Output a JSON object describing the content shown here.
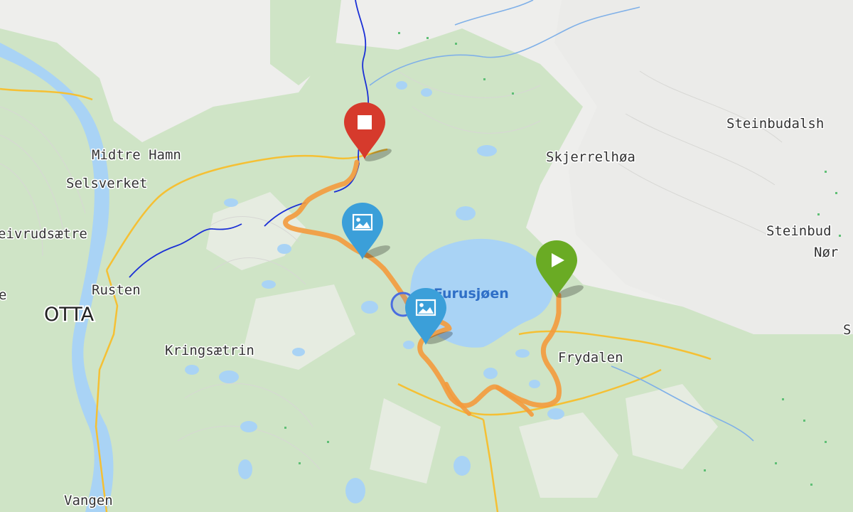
{
  "map": {
    "places": [
      {
        "key": "midtre-hamn",
        "name": "Midtre Hamn"
      },
      {
        "key": "selsverket",
        "name": "Selsverket"
      },
      {
        "key": "eivrudsaetre",
        "name": "eivrudsætre"
      },
      {
        "key": "rusten",
        "name": "Rusten"
      },
      {
        "key": "otta",
        "name": "OTTA"
      },
      {
        "key": "kringsaetrin",
        "name": "Kringsætrin"
      },
      {
        "key": "vangen",
        "name": "Vangen"
      },
      {
        "key": "skjerrelhoa",
        "name": "Skjerrelhøa"
      },
      {
        "key": "steinbudalsh",
        "name": "Steinbudalsh"
      },
      {
        "key": "steinbud",
        "name": "Steinbud"
      },
      {
        "key": "nor",
        "name": "Nør"
      },
      {
        "key": "frydalen",
        "name": "Frydalen"
      },
      {
        "key": "s-edge",
        "name": "S"
      },
      {
        "key": "e-edge",
        "name": "e"
      }
    ],
    "lake_name": "Furusjøen",
    "markers": [
      {
        "key": "end",
        "type": "stop",
        "icon": "stop-square-icon",
        "color": "#d63a2c"
      },
      {
        "key": "photo1",
        "type": "photo",
        "icon": "image-icon",
        "color": "#3b9fd9"
      },
      {
        "key": "photo2",
        "type": "photo",
        "icon": "image-icon",
        "color": "#3b9fd9"
      },
      {
        "key": "start",
        "type": "start",
        "icon": "play-triangle-icon",
        "color": "#6aab24"
      }
    ],
    "colors": {
      "route": "#f39a3c",
      "road": "#f5c034",
      "river": "#1a2fd6",
      "water": "#a9d3f5",
      "forest": "#cfe4c6",
      "background": "#eeeeec"
    }
  }
}
